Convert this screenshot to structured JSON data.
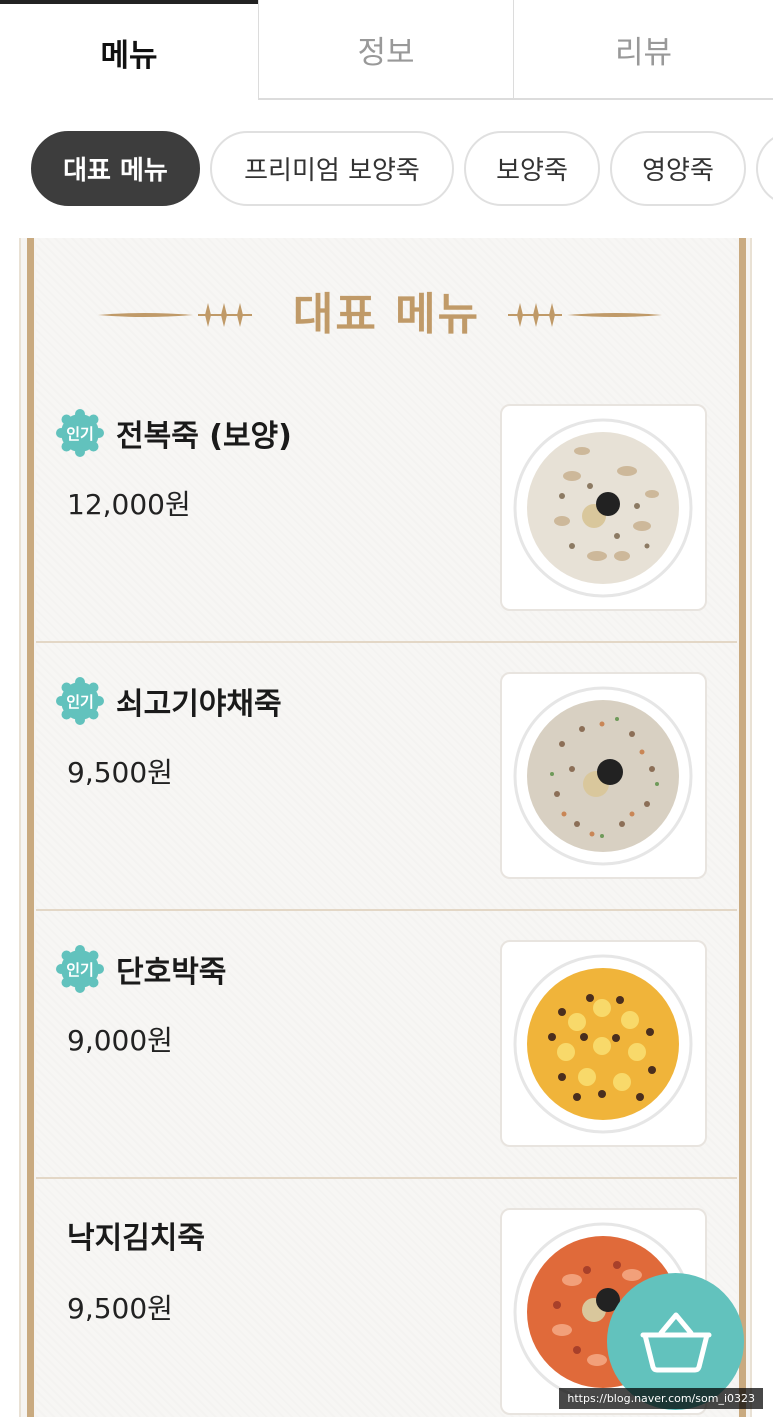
{
  "tabs": [
    {
      "label": "메뉴",
      "active": true
    },
    {
      "label": "정보",
      "active": false
    },
    {
      "label": "리뷰",
      "active": false
    }
  ],
  "categories": [
    {
      "label": "대표 메뉴",
      "active": true
    },
    {
      "label": "프리미엄 보양죽",
      "active": false
    },
    {
      "label": "보양죽",
      "active": false
    },
    {
      "label": "영양죽",
      "active": false
    }
  ],
  "section": {
    "title": "대표 메뉴"
  },
  "menu_items": [
    {
      "badge": "인기",
      "name": "전복죽 (보양)",
      "price": "12,000원",
      "image": "abalone-porridge"
    },
    {
      "badge": "인기",
      "name": "쇠고기야채죽",
      "price": "9,500원",
      "image": "beef-vegetable-porridge"
    },
    {
      "badge": "인기",
      "name": "단호박죽",
      "price": "9,000원",
      "image": "pumpkin-porridge"
    },
    {
      "badge": "",
      "name": "낙지김치죽",
      "price": "9,500원",
      "image": "octopus-kimchi-porridge"
    }
  ],
  "cart": {
    "icon": "basket-icon"
  },
  "watermark": "https://blog.naver.com/som_i0323",
  "colors": {
    "accent": "#62c2bd",
    "gold": "#c09a68",
    "frame": "#c9aa80",
    "chip_active": "#3d3d3d"
  }
}
